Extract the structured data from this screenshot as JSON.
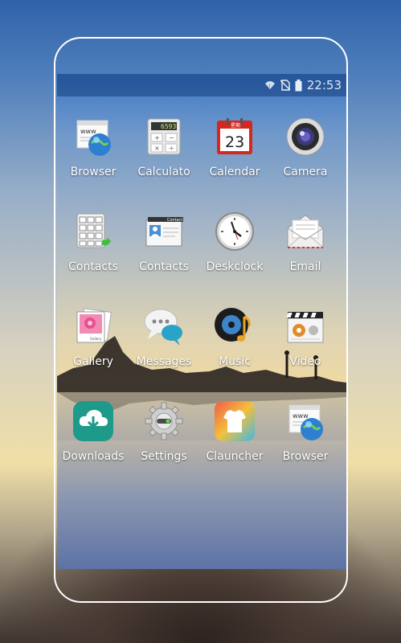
{
  "status_bar": {
    "time": "22:53",
    "icons": [
      "wifi-icon",
      "no-sim-icon",
      "battery-icon"
    ]
  },
  "apps": [
    {
      "label": "Browser",
      "icon": "browser-icon"
    },
    {
      "label": "Calculato",
      "icon": "calculator-icon",
      "display": "6593"
    },
    {
      "label": "Calendar",
      "icon": "calendar-icon",
      "day": "23",
      "header": "星期"
    },
    {
      "label": "Camera",
      "icon": "camera-icon"
    },
    {
      "label": "Contacts",
      "icon": "dialpad-icon"
    },
    {
      "label": "Contacts",
      "icon": "contacts-card-icon",
      "header": "Contact"
    },
    {
      "label": "Deskclock",
      "icon": "clock-icon"
    },
    {
      "label": "Email",
      "icon": "email-icon"
    },
    {
      "label": "Gallery",
      "icon": "gallery-icon",
      "caption": "Gallery"
    },
    {
      "label": "Messages",
      "icon": "messages-icon"
    },
    {
      "label": "Music",
      "icon": "music-icon"
    },
    {
      "label": "Video",
      "icon": "video-icon"
    },
    {
      "label": "Downloads",
      "icon": "download-icon"
    },
    {
      "label": "Settings",
      "icon": "settings-icon"
    },
    {
      "label": "Clauncher",
      "icon": "launcher-shirt-icon"
    },
    {
      "label": "Browser",
      "icon": "browser-icon"
    }
  ]
}
